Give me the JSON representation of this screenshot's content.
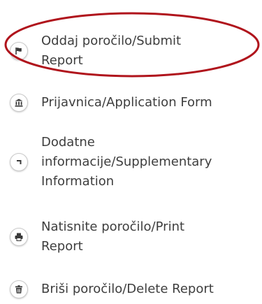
{
  "menu": {
    "items": [
      {
        "lines": [
          "Oddaj poročilo/Submit",
          "Report"
        ],
        "icon": "flag-icon"
      },
      {
        "lines": [
          "Prijavnica/Application Form"
        ],
        "icon": "institution-icon"
      },
      {
        "lines": [
          "Dodatne",
          "informacije/Supplementary",
          "Information"
        ],
        "icon": "arrow-icon"
      },
      {
        "lines": [
          "Natisnite poročilo/Print",
          "Report"
        ],
        "icon": "print-icon"
      },
      {
        "lines": [
          "Briši poročilo/Delete Report"
        ],
        "icon": "trash-icon"
      }
    ]
  },
  "colors": {
    "text": "#3e3e3e",
    "highlight": "#b0141c",
    "icon": "#3a3a3a"
  }
}
